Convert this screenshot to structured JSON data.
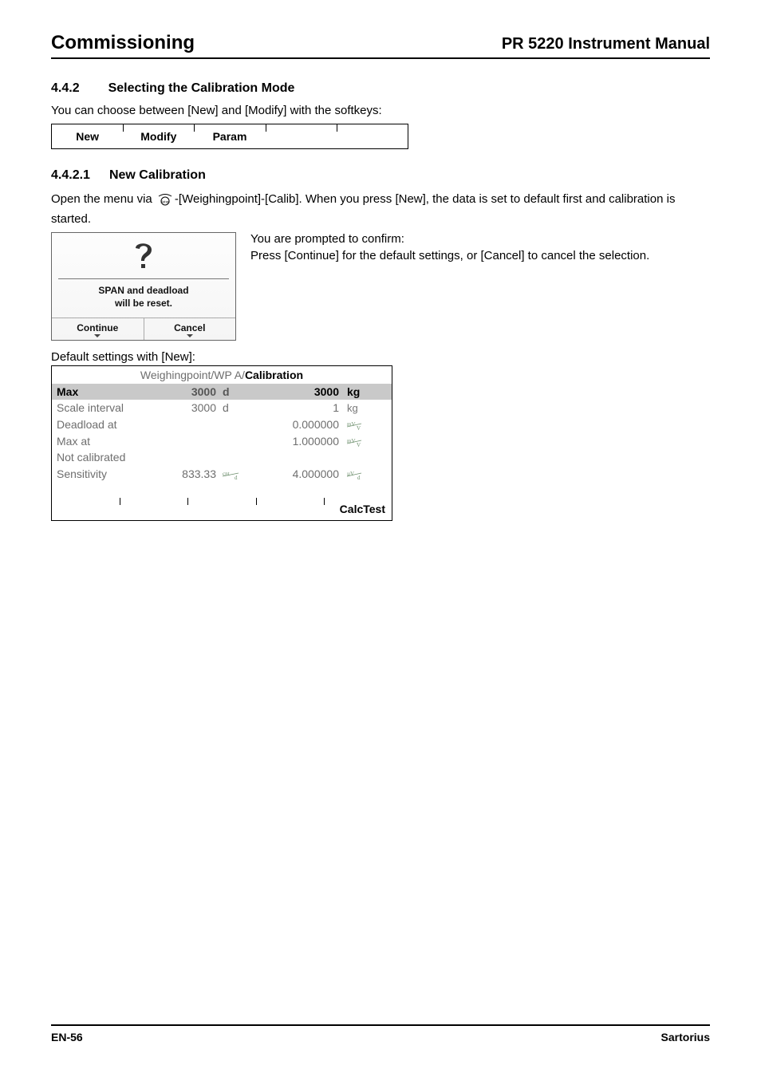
{
  "header": {
    "left": "Commissioning",
    "right": "PR 5220 Instrument Manual"
  },
  "section": {
    "num": "4.4.2",
    "title": "Selecting the Calibration Mode"
  },
  "intro": "You can choose between [New] and [Modify] with the softkeys:",
  "softkeys": {
    "s1": "New",
    "s2": "Modify",
    "s3": "Param",
    "s4": "",
    "s5": ""
  },
  "subsection": {
    "num": "4.4.2.1",
    "title": "New Calibration"
  },
  "sub_intro_pre": "Open the menu via ",
  "sub_intro_post": "-[Weighingpoint]-[Calib]. When you press [New], the data is set to default first and calibration is started.",
  "dialog": {
    "msg_l1": "SPAN and deadload",
    "msg_l2": "will be reset.",
    "continue": "Continue",
    "cancel": "Cancel"
  },
  "aside": {
    "line1": "You are prompted to confirm:",
    "line2": "Press [Continue] for the default settings, or [Cancel] to cancel the selection."
  },
  "defaults_label": "Default settings with [New]:",
  "cal": {
    "title_pre": "Weighingpoint/WP A/",
    "title_strong": "Calibration",
    "rows": {
      "max": {
        "label": "Max",
        "v1": "3000",
        "u1": "d",
        "v2": "3000",
        "u2": "kg"
      },
      "interval": {
        "label": "Scale interval",
        "v1": "3000",
        "u1": "d",
        "v2": "1",
        "u2": "kg"
      },
      "deadload": {
        "label": "Deadload at",
        "v1": "",
        "u1": "",
        "v2": "0.000000",
        "u2": "mV/V"
      },
      "maxat": {
        "label": "Max  at",
        "v1": "",
        "u1": "",
        "v2": "1.000000",
        "u2": "mV/V"
      },
      "notcal": {
        "label": "Not calibrated",
        "v1": "",
        "u1": "",
        "v2": "",
        "u2": ""
      },
      "sens": {
        "label": "Sensitivity",
        "v1": "833.33",
        "u1": "cnt/d",
        "v2": "4.000000",
        "u2": "µV/d"
      }
    },
    "footer_button": "CalcTest"
  },
  "footer": {
    "left": "EN-56",
    "right": "Sartorius"
  }
}
